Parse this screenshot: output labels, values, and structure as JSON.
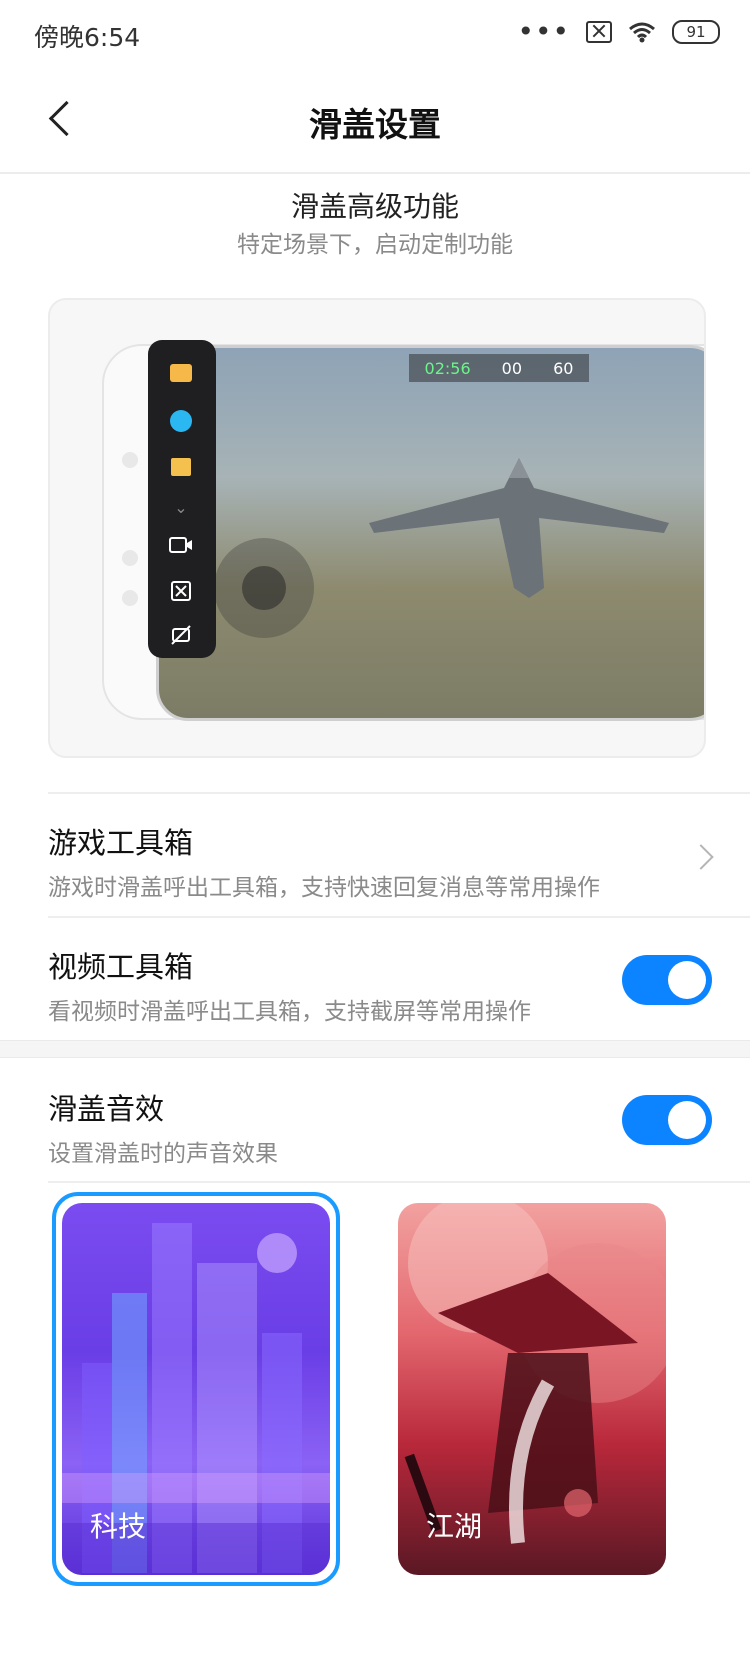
{
  "status": {
    "time": "傍晚6:54",
    "battery": "91"
  },
  "header": {
    "title": "滑盖设置"
  },
  "intro": {
    "title": "滑盖高级功能",
    "subtitle": "特定场景下，启动定制功能"
  },
  "preview": {
    "hud_time": "02:56",
    "hud_mid": "00",
    "hud_count": "60"
  },
  "settings": [
    {
      "title": "游戏工具箱",
      "subtitle": "游戏时滑盖呼出工具箱，支持快速回复消息等常用操作"
    },
    {
      "title": "视频工具箱",
      "subtitle": "看视频时滑盖呼出工具箱，支持截屏等常用操作",
      "enabled": true
    },
    {
      "title": "滑盖音效",
      "subtitle": "设置滑盖时的声音效果",
      "enabled": true
    }
  ],
  "sound_themes": [
    {
      "label": "科技",
      "selected": true
    },
    {
      "label": "江湖",
      "selected": false
    }
  ],
  "colors": {
    "accent": "#0d84ff",
    "selected_border": "#1a9bff"
  }
}
